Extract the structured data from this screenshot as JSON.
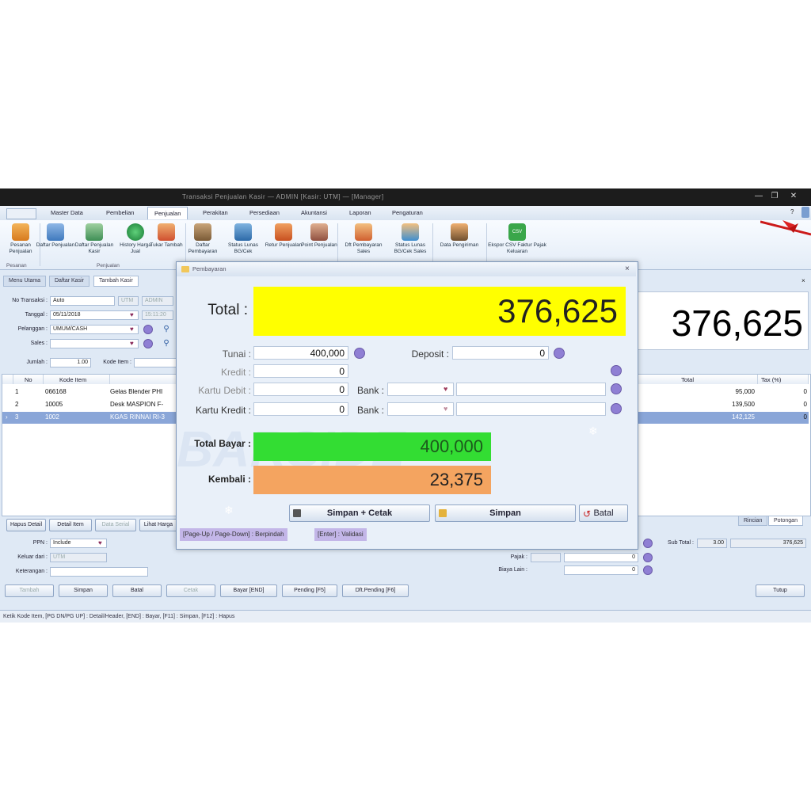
{
  "window": {
    "title": "Transaksi Penjualan Kasir — ADMIN [Kasir: UTM] — [Manager]"
  },
  "menu": {
    "items": [
      "Master Data",
      "Pembelian",
      "Penjualan",
      "Perakitan",
      "Persediaan",
      "Akuntansi",
      "Laporan",
      "Pengaturan"
    ],
    "active": "Penjualan"
  },
  "ribbon": {
    "buttons": [
      {
        "label": "Pesanan Penjualan",
        "icon": "order-icon"
      },
      {
        "label": "Daftar Penjualan",
        "icon": "cart-list-icon"
      },
      {
        "label": "Daftar Penjualan Kasir",
        "icon": "cashier-list-icon"
      },
      {
        "label": "History Harga Jual",
        "icon": "history-icon"
      },
      {
        "label": "Tukar Tambah",
        "icon": "trade-in-icon"
      },
      {
        "label": "Daftar Pembayaran",
        "icon": "payment-list-icon"
      },
      {
        "label": "Status Lunas BG/Cek",
        "icon": "cheque-status-icon"
      },
      {
        "label": "Retur Penjualan",
        "icon": "return-icon"
      },
      {
        "label": "Point Penjualan",
        "icon": "point-icon"
      },
      {
        "label": "Dft Pembayaran Sales",
        "icon": "sales-payment-icon"
      },
      {
        "label": "Status Lunas BG/Cek Sales",
        "icon": "sales-cheque-icon"
      },
      {
        "label": "Data Pengiriman",
        "icon": "delivery-icon"
      },
      {
        "label": "Ekspor CSV Faktur Pajak Keluaran",
        "icon": "csv-icon"
      }
    ],
    "groups": [
      "Pesanan",
      "Penjualan"
    ],
    "csv_badge": "CSV"
  },
  "doctabs": [
    "Menu Utama",
    "Daftar Kasir",
    "Tambah Kasir"
  ],
  "form": {
    "no_transaksi_label": "No Transaksi :",
    "no_transaksi": "Auto",
    "no_transaksi_code": "UTM",
    "user": "ADMIN",
    "tanggal_label": "Tanggal :",
    "tanggal": "05/11/2018",
    "time": "15:11:20",
    "pelanggan_label": "Pelanggan :",
    "pelanggan": "UMUM/CASH",
    "sales_label": "Sales :",
    "sales": "",
    "jumlah_label": "Jumlah :",
    "jumlah": "1.00",
    "kode_item_label": "Kode Item :"
  },
  "big_total": "376,625",
  "grid": {
    "headers": [
      "No",
      "Kode Item",
      "Total",
      "Tax (%)"
    ],
    "rows": [
      {
        "no": "1",
        "kode": "066168",
        "nama": "Gelas Blender PHI",
        "total": "95,000",
        "tax": "0"
      },
      {
        "no": "2",
        "kode": "10005",
        "nama": "Desk MASPION F-",
        "total": "139,500",
        "tax": "0"
      },
      {
        "no": "3",
        "kode": "1002",
        "nama": "KGAS RINNAI RI-3",
        "total": "142,125",
        "tax": "0"
      }
    ]
  },
  "detail_buttons": [
    "Hapus Detail",
    "Detail Item",
    "Data Serial",
    "Lihat Harga"
  ],
  "right_tabs": [
    "Rincian",
    "Potongan"
  ],
  "bottom_form": {
    "ppn_label": "PPN :",
    "ppn": "Include",
    "keluar_label": "Keluar dari :",
    "keluar": "UTM",
    "keterangan_label": "Keterangan :",
    "subtotal_label": "Sub Total :",
    "subtotal_qty": "3.00",
    "subtotal": "376,625",
    "pajak_label": "Pajak :",
    "pajak": "0",
    "biaya_label": "Biaya Lain :",
    "biaya": "0"
  },
  "footer_buttons": [
    "Tambah",
    "Simpan",
    "Batal",
    "Cetak",
    "Bayar [END]",
    "Pending [F5]",
    "Dft.Pending [F6]",
    "Tutup"
  ],
  "status": "Ketik Kode Item, [PG DN/PG UP] : Detail/Header, [END] : Bayar, [F11] : Simpan, [F12] : Hapus",
  "dialog": {
    "title": "Pembayaran",
    "total_label": "Total :",
    "total": "376,625",
    "tunai_label": "Tunai :",
    "tunai": "400,000",
    "deposit_label": "Deposit :",
    "deposit": "0",
    "kredit_label": "Kredit :",
    "kredit": "0",
    "kartu_debit_label": "Kartu Debit :",
    "kartu_debit": "0",
    "kartu_kredit_label": "Kartu Kredit :",
    "kartu_kredit": "0",
    "bank_label": "Bank :",
    "total_bayar_label": "Total Bayar :",
    "total_bayar": "400,000",
    "kembali_label": "Kembali :",
    "kembali": "23,375",
    "btn_simpan_cetak": "Simpan + Cetak",
    "btn_simpan": "Simpan",
    "btn_batal": "Batal",
    "hint1": "[Page-Up / Page-Down] : Berpindah",
    "hint2": "[Enter] : Validasi",
    "watermark": "BARSIDE"
  },
  "colors": {
    "total_bg": "#ffff00",
    "bayar_bg": "#33dd33",
    "kembali_bg": "#f4a460",
    "selected_row": "#8aa6d8"
  }
}
